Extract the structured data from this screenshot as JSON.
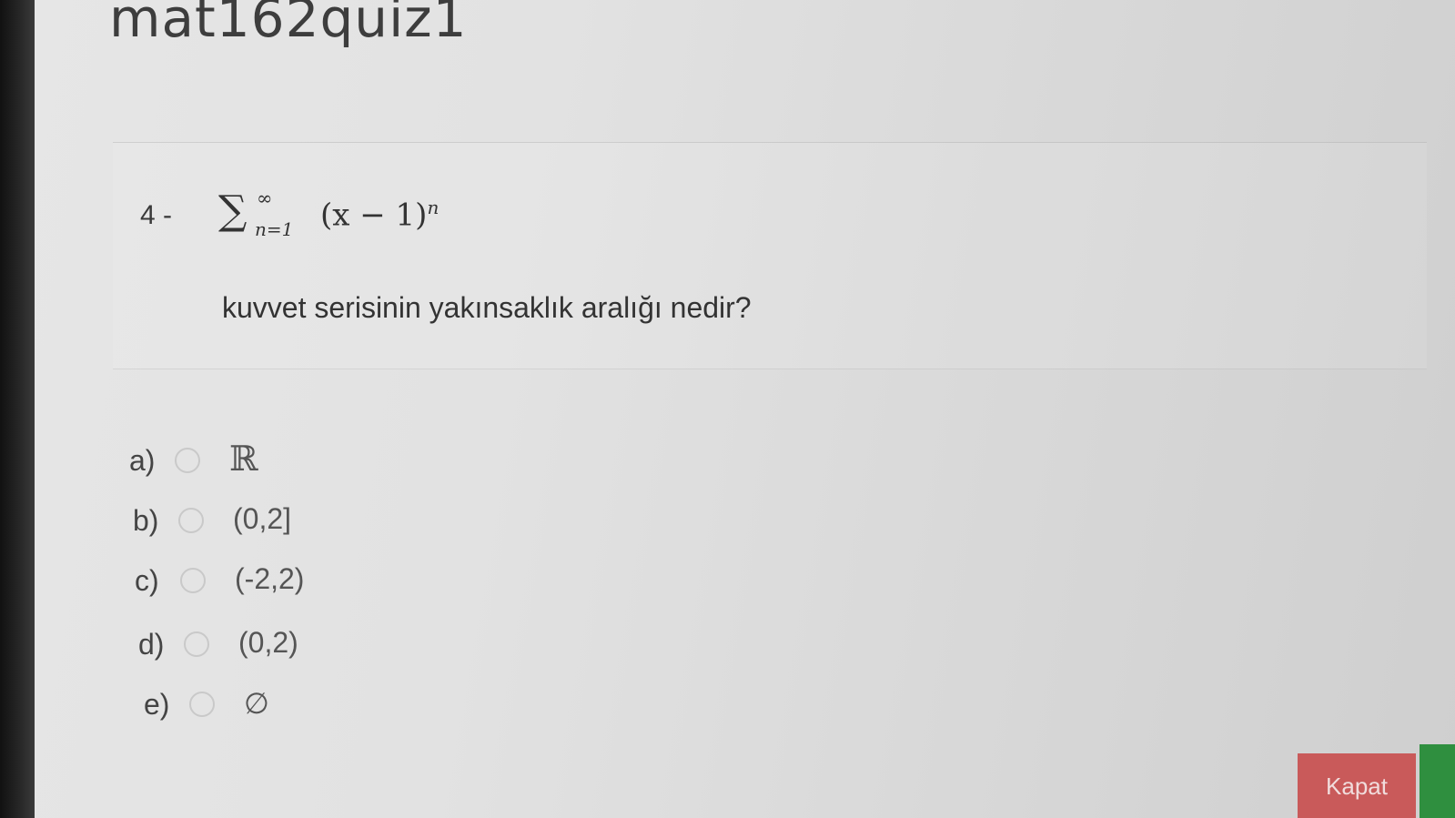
{
  "page": {
    "title": "mat162quiz1"
  },
  "question": {
    "number": "4 -",
    "formula": {
      "sigma": "∑",
      "upper": "∞",
      "lower": "n=1",
      "body": "(x − 1)",
      "exponent": "n"
    },
    "text": "kuvvet serisinin yakınsaklık aralığı nedir?"
  },
  "options": [
    {
      "letter": "a)",
      "value": "ℝ"
    },
    {
      "letter": "b)",
      "value": "(0,2]"
    },
    {
      "letter": "c)",
      "value": "(-2,2)"
    },
    {
      "letter": "d)",
      "value": "(0,2)"
    },
    {
      "letter": "e)",
      "value": "∅"
    }
  ],
  "footer": {
    "close_label": "Kapat"
  },
  "colors": {
    "close_button": "#c95a5a",
    "confirm_strip": "#2f8f3f"
  }
}
